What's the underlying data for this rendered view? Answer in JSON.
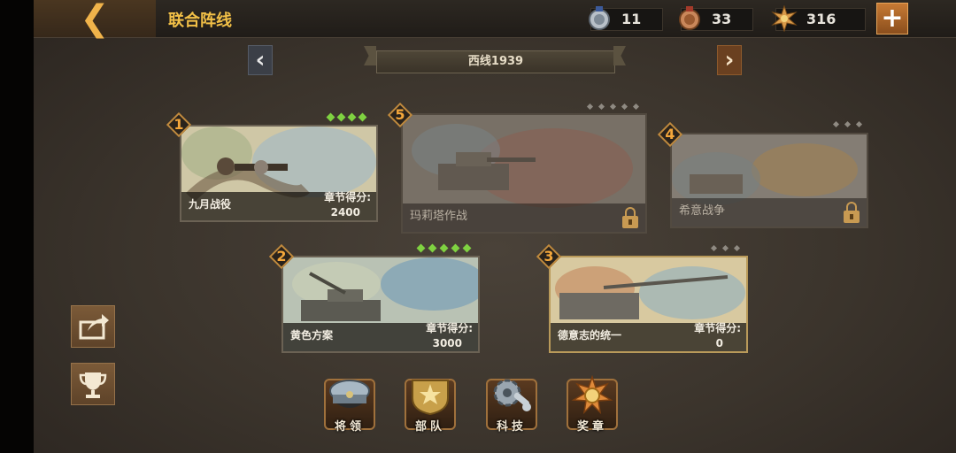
{
  "header": {
    "back_icon": "chevron-left-icon",
    "title": "联合阵线",
    "resources": [
      {
        "icon": "silver-medal-icon",
        "value": "11"
      },
      {
        "icon": "bronze-medal-icon",
        "value": "33"
      },
      {
        "icon": "gold-star-emblem-icon",
        "value": "316"
      }
    ],
    "add_icon": "plus-icon"
  },
  "campaign": {
    "prev_icon": "chevron-left-icon",
    "name": "西线1939",
    "next_icon": "chevron-right-icon"
  },
  "chapters": [
    {
      "number": "1",
      "name": "九月战役",
      "score_label": "章节得分:",
      "score": "2400",
      "stars_earned": 4,
      "stars_total": 4,
      "locked": false
    },
    {
      "number": "5",
      "name": "玛莉塔作战",
      "score_label": "",
      "score": "",
      "stars_earned": 0,
      "stars_total": 5,
      "locked": true
    },
    {
      "number": "4",
      "name": "希意战争",
      "score_label": "",
      "score": "",
      "stars_earned": 0,
      "stars_total": 3,
      "locked": true
    },
    {
      "number": "2",
      "name": "黄色方案",
      "score_label": "章节得分:",
      "score": "3000",
      "stars_earned": 5,
      "stars_total": 5,
      "locked": false
    },
    {
      "number": "3",
      "name": "德意志的统一",
      "score_label": "章节得分:",
      "score": "0",
      "stars_earned": 0,
      "stars_total": 3,
      "locked": false
    }
  ],
  "side_buttons": [
    {
      "icon": "share-icon"
    },
    {
      "icon": "trophy-icon"
    }
  ],
  "bottom_menu": [
    {
      "icon": "officer-cap-icon",
      "label": "将领"
    },
    {
      "icon": "army-insignia-icon",
      "label": "部队"
    },
    {
      "icon": "gear-wrench-icon",
      "label": "科技"
    },
    {
      "icon": "medal-icon",
      "label": "奖章"
    }
  ],
  "colors": {
    "accent_gold": "#f2c047",
    "badge_orange": "#f4a73b",
    "star_green": "#7fd241",
    "background": "#3b342c"
  }
}
